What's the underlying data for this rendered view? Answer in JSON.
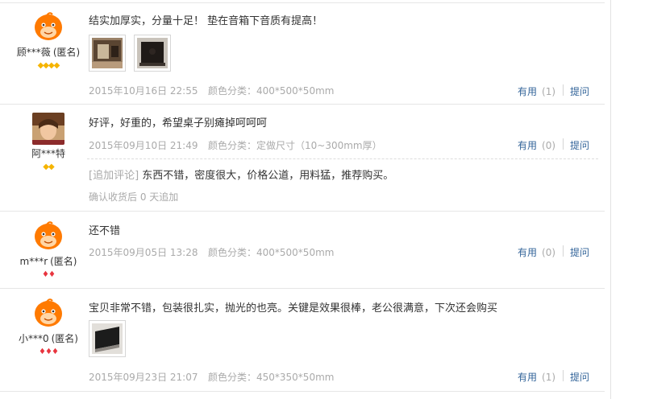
{
  "reviews": [
    {
      "username": "顾***薇",
      "anonymous": "(匿名)",
      "level_icons": "◆◆◆◆",
      "level_color": "#f5b400",
      "avatar": "taobao-mascot-orange",
      "content": "结实加厚实，分量十足！ 垫在音箱下音质有提高！",
      "date": "2015年10月16日 22:55",
      "sku": "颜色分类：400*500*50mm",
      "useful_label": "有用",
      "useful_count": "(1)",
      "ask_label": "提问"
    },
    {
      "username": "阿***特",
      "anonymous": "",
      "level_icons": "◆◆",
      "level_color": "#f5b400",
      "avatar": "user-photo",
      "content": "好评，好重的，希望桌子别瘫掉呵呵呵",
      "date": "2015年09月10日 21:49",
      "sku": "颜色分类：定做尺寸（10~300mm厚）",
      "useful_label": "有用",
      "useful_count": "(0)",
      "ask_label": "提问",
      "append_tag": "[追加评论]",
      "append_text": "东西不错，密度很大，价格公道，用料猛，推荐购买。",
      "confirm_text": "确认收货后 0 天追加"
    },
    {
      "username": "m***r",
      "anonymous": "(匿名)",
      "level_icons": "♦♦",
      "level_color": "#e8353f",
      "avatar": "taobao-mascot-orange",
      "content": "还不错",
      "date": "2015年09月05日 13:28",
      "sku": "颜色分类：400*500*50mm",
      "useful_label": "有用",
      "useful_count": "(0)",
      "ask_label": "提问"
    },
    {
      "username": "小***0",
      "anonymous": "(匿名)",
      "level_icons": "♦♦♦",
      "level_color": "#e8353f",
      "avatar": "taobao-mascot-orange",
      "content": "宝贝非常不错，包装很扎实，抛光的也亮。关键是效果很棒，老公很满意，下次还会购买",
      "date": "2015年09月23日 21:07",
      "sku": "颜色分类：450*350*50mm",
      "useful_label": "有用",
      "useful_count": "(1)",
      "ask_label": "提问"
    }
  ]
}
